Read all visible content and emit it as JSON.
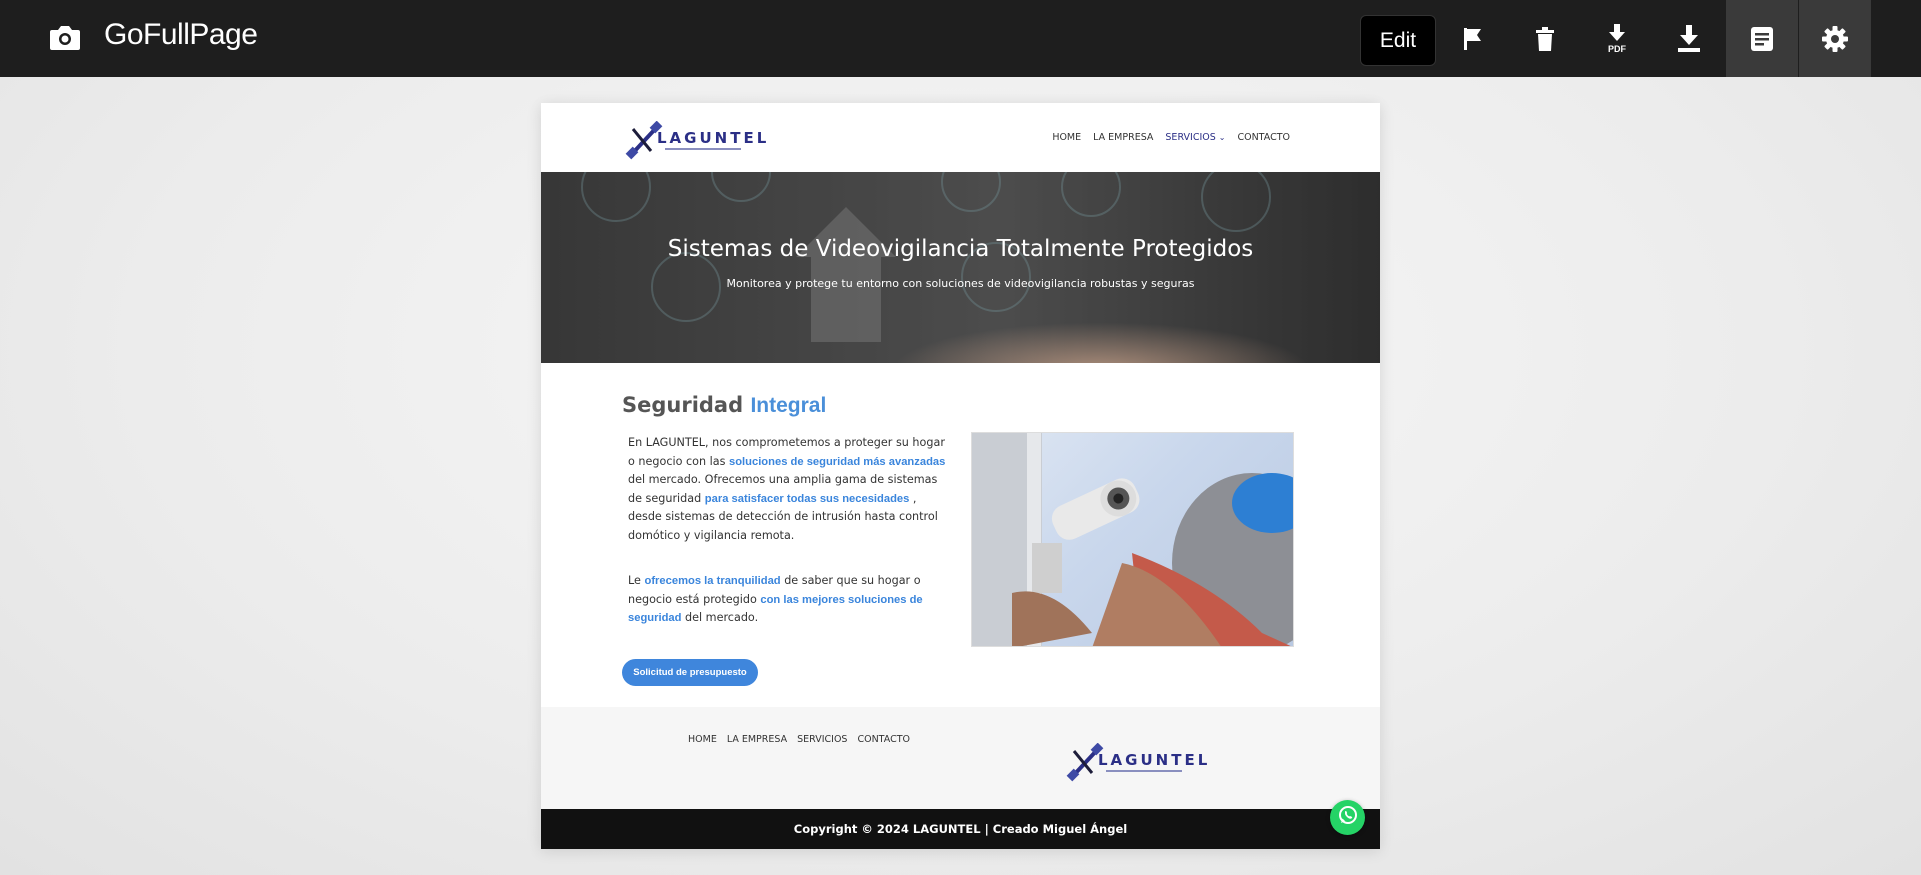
{
  "toolbar": {
    "app_title": "GoFullPage",
    "edit_label": "Edit",
    "pdf_label": "PDF",
    "icons": [
      "camera-icon",
      "flag-icon",
      "trash-icon",
      "pdf-download-icon",
      "download-icon",
      "document-icon",
      "gear-icon"
    ]
  },
  "site": {
    "logo_text": "LAGUNTEL",
    "nav": [
      {
        "label": "HOME"
      },
      {
        "label": "LA EMPRESA"
      },
      {
        "label": "SERVICIOS"
      },
      {
        "label": "CONTACTO"
      }
    ],
    "hero": {
      "title": "Sistemas de Videovigilancia Totalmente Protegidos",
      "subtitle": "Monitorea y protege tu entorno con soluciones de videovigilancia robustas y seguras"
    },
    "section": {
      "title_plain": "Seguridad ",
      "title_accent": "Integral",
      "p1": [
        "En LAGUNTEL, nos comprometemos a proteger su hogar o negocio con las ",
        "soluciones de seguridad más avanzadas",
        " del mercado. Ofrecemos una amplia gama de sistemas de seguridad ",
        "para satisfacer todas sus necesidades",
        " , desde sistemas de detección de intrusión hasta control domótico y vigilancia remota."
      ],
      "p2": [
        "Le ",
        "ofrecemos la tranquilidad",
        " de saber que su hogar o negocio está protegido ",
        "con las mejores soluciones de seguridad",
        " del mercado."
      ],
      "cta_label": "Solicitud de presupuesto"
    },
    "footer": {
      "nav": [
        {
          "label": "HOME"
        },
        {
          "label": "LA EMPRESA"
        },
        {
          "label": "SERVICIOS"
        },
        {
          "label": "CONTACTO"
        }
      ],
      "copyright": "Copyright © 2024 LAGUNTEL | Creado Miguel Ángel"
    }
  },
  "colors": {
    "toolbar_bg": "#1e1e1e",
    "accent_blue": "#3f86dc",
    "brand_navy": "#2b2f86",
    "whatsapp_green": "#25d366"
  }
}
